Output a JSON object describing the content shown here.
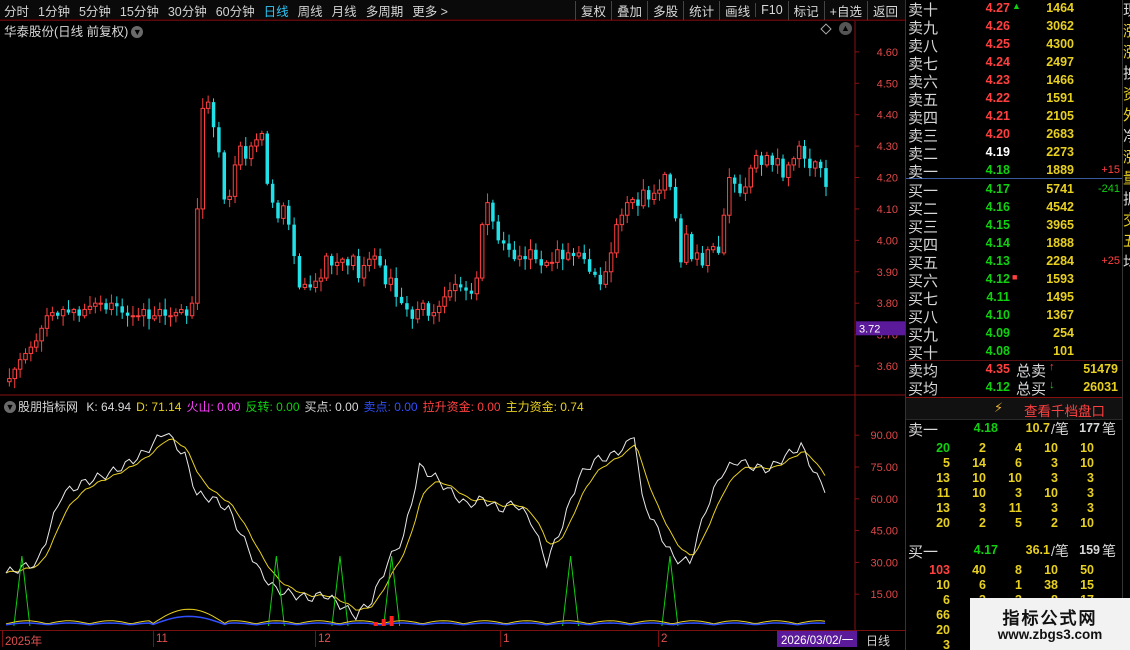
{
  "toolbar": {
    "periods": [
      "分时",
      "1分钟",
      "5分钟",
      "15分钟",
      "30分钟",
      "60分钟",
      "日线",
      "周线",
      "月线",
      "多周期",
      "更多 >"
    ],
    "active_period": "日线",
    "tools": [
      "复权",
      "叠加",
      "多股",
      "统计",
      "画线",
      "F10",
      "标记",
      "+自选",
      "返回"
    ]
  },
  "main_chart": {
    "title": "华泰股份(日线 前复权)",
    "y_ticks": [
      "4.60",
      "4.50",
      "4.40",
      "4.30",
      "4.20",
      "4.10",
      "4.00",
      "3.90",
      "3.80",
      "3.70",
      "3.60"
    ],
    "current_price_tag": "3.72"
  },
  "indicator": {
    "name": "股朋指标网",
    "items": [
      {
        "label": "K: 64.94",
        "color": "#d8d8d8"
      },
      {
        "label": "D: 71.14",
        "color": "#e8d020"
      },
      {
        "label": "火山: 0.00",
        "color": "#ff40ff"
      },
      {
        "label": "反转: 0.00",
        "color": "#10d010"
      },
      {
        "label": "买点: 0.00",
        "color": "#d8d8d8"
      },
      {
        "label": "卖点: 0.00",
        "color": "#3050ff"
      },
      {
        "label": "拉升资金: 0.00",
        "color": "#ff4040"
      },
      {
        "label": "主力资金: 0.74",
        "color": "#e8d020"
      }
    ],
    "y_ticks": [
      "90.00",
      "75.00",
      "60.00",
      "45.00",
      "30.00",
      "15.00"
    ]
  },
  "time_axis": {
    "labels": [
      "2025年",
      "11",
      "12",
      "1",
      "2"
    ],
    "cursor_date": "2026/03/02/一",
    "period_label": "日线"
  },
  "order_book": {
    "asks": [
      {
        "label": "卖十",
        "price": "4.27",
        "marker": "▲",
        "volume": "1464",
        "change": ""
      },
      {
        "label": "卖九",
        "price": "4.26",
        "marker": "",
        "volume": "3062",
        "change": ""
      },
      {
        "label": "卖八",
        "price": "4.25",
        "marker": "",
        "volume": "4300",
        "change": ""
      },
      {
        "label": "卖七",
        "price": "4.24",
        "marker": "",
        "volume": "2497",
        "change": ""
      },
      {
        "label": "卖六",
        "price": "4.23",
        "marker": "",
        "volume": "1466",
        "change": ""
      },
      {
        "label": "卖五",
        "price": "4.22",
        "marker": "",
        "volume": "1591",
        "change": ""
      },
      {
        "label": "卖四",
        "price": "4.21",
        "marker": "",
        "volume": "2105",
        "change": ""
      },
      {
        "label": "卖三",
        "price": "4.20",
        "marker": "",
        "volume": "2683",
        "change": ""
      },
      {
        "label": "卖二",
        "price": "4.19",
        "marker": "",
        "volume": "2273",
        "change": ""
      },
      {
        "label": "卖一",
        "price": "4.18",
        "marker": "",
        "volume": "1889",
        "change": "+15"
      }
    ],
    "bids": [
      {
        "label": "买一",
        "price": "4.17",
        "marker": "",
        "volume": "5741",
        "change": "-241"
      },
      {
        "label": "买二",
        "price": "4.16",
        "marker": "",
        "volume": "4542",
        "change": ""
      },
      {
        "label": "买三",
        "price": "4.15",
        "marker": "",
        "volume": "3965",
        "change": ""
      },
      {
        "label": "买四",
        "price": "4.14",
        "marker": "",
        "volume": "1888",
        "change": ""
      },
      {
        "label": "买五",
        "price": "4.13",
        "marker": "",
        "volume": "2284",
        "change": "+25"
      },
      {
        "label": "买六",
        "price": "4.12",
        "marker": "■",
        "volume": "1593",
        "change": ""
      },
      {
        "label": "买七",
        "price": "4.11",
        "marker": "",
        "volume": "1495",
        "change": ""
      },
      {
        "label": "买八",
        "price": "4.10",
        "marker": "",
        "volume": "1367",
        "change": ""
      },
      {
        "label": "买九",
        "price": "4.09",
        "marker": "",
        "volume": "254",
        "change": ""
      },
      {
        "label": "买十",
        "price": "4.08",
        "marker": "",
        "volume": "101",
        "change": ""
      }
    ],
    "summary": {
      "ask_avg_label": "卖均",
      "ask_avg": "4.35",
      "ask_total_label": "总卖",
      "ask_total": "51479",
      "bid_avg_label": "买均",
      "bid_avg": "4.12",
      "bid_total_label": "总买",
      "bid_total": "26031"
    }
  },
  "depth": {
    "button": "查看千档盘口",
    "ask_head": {
      "label": "卖一",
      "price": "4.18",
      "avg": "10.7",
      "unit1": "/笔",
      "count": "177",
      "unit2": "笔"
    },
    "ask_rows": [
      [
        "20",
        "2",
        "4",
        "10",
        "10"
      ],
      [
        "5",
        "14",
        "6",
        "3",
        "10"
      ],
      [
        "13",
        "10",
        "10",
        "3",
        "3"
      ],
      [
        "11",
        "10",
        "3",
        "10",
        "3"
      ],
      [
        "13",
        "3",
        "11",
        "3",
        "3"
      ],
      [
        "20",
        "2",
        "5",
        "2",
        "10"
      ]
    ],
    "bid_head": {
      "label": "买一",
      "price": "4.17",
      "avg": "36.1",
      "unit1": "/笔",
      "count": "159",
      "unit2": "笔"
    },
    "bid_rows": [
      [
        "103",
        "40",
        "8",
        "10",
        "50"
      ],
      [
        "10",
        "6",
        "1",
        "38",
        "15"
      ],
      [
        "6",
        "3",
        "3",
        "8",
        "17"
      ],
      [
        "66",
        "",
        "",
        "",
        ""
      ],
      [
        "20",
        "1",
        "",
        "",
        ""
      ],
      [
        "3",
        "",
        "",
        "",
        ""
      ]
    ]
  },
  "side_strip": [
    "现",
    "涨",
    "涨",
    "换",
    "资",
    "外",
    "净",
    "涨",
    "量",
    "振",
    "交",
    "五",
    "均"
  ],
  "watermark": {
    "line1": "指标公式网",
    "line2": "www.zbgs3.com"
  },
  "colors": {
    "up": "#ff4040",
    "down": "#20e0e8",
    "k_line": "#e8e8e8",
    "d_line": "#e8d020",
    "signal": "#10d010"
  }
}
